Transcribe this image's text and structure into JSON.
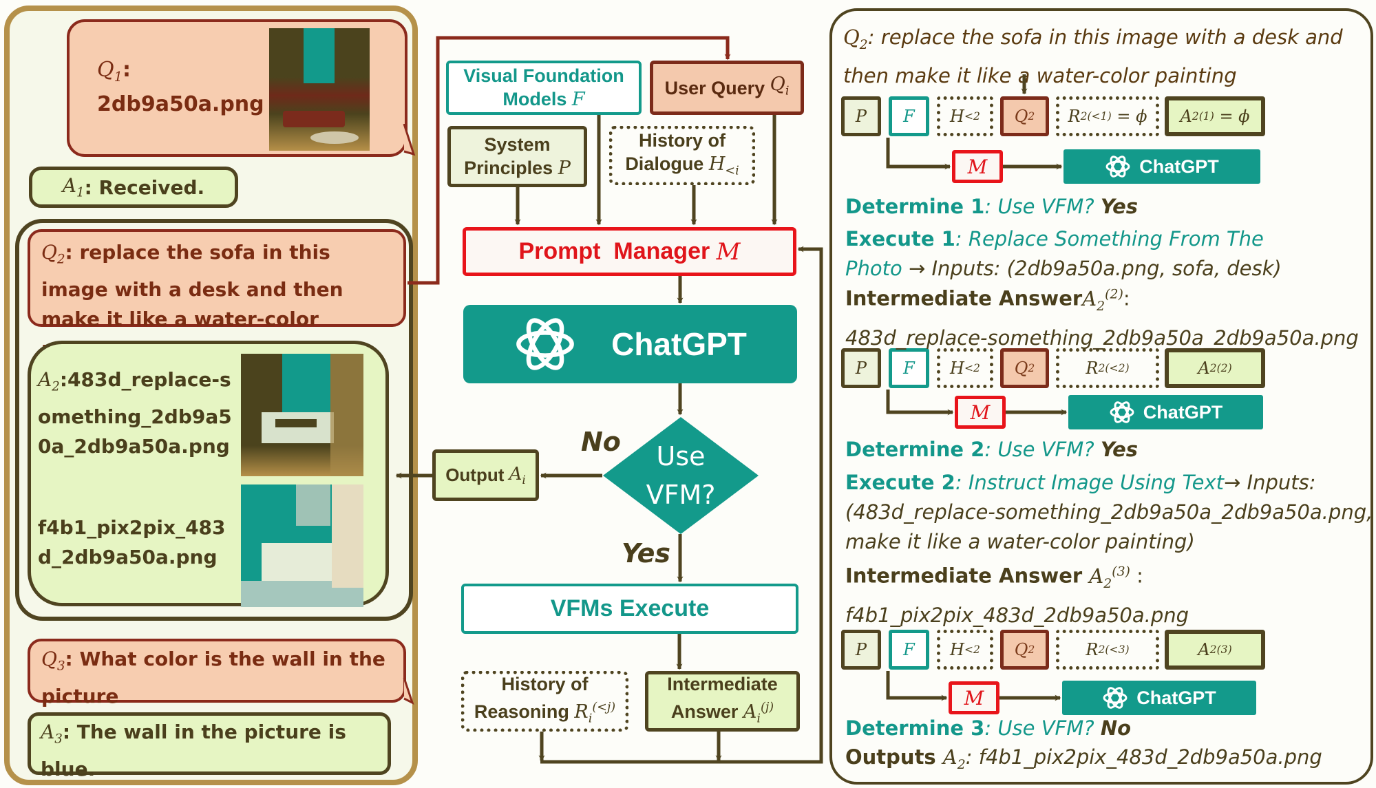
{
  "left_panel": {
    "q1": {
      "label": "Q",
      "sub": "1",
      "colon": ":",
      "text": "2db9a50a.png",
      "image": "living-room-sofa-photo"
    },
    "a1": {
      "label": "A",
      "sub": "1",
      "text": ": Received."
    },
    "q2": {
      "label": "Q",
      "sub": "2",
      "text": ": replace the sofa in this image with a desk and then make it like a water-color painting"
    },
    "a2": {
      "label": "A",
      "sub": "2",
      "text1": ":483d_replace-something_2db9a50a_2db9a50a.png",
      "text2": "f4b1_pix2pix_483d_2db9a50a.png",
      "image1": "desk-replaced-photo",
      "image2": "watercolor-desk-photo"
    },
    "q3": {
      "label": "Q",
      "sub": "3",
      "text": ": What color is the wall in the picture"
    },
    "a3": {
      "label": "A",
      "sub": "3",
      "text": ": The wall in the picture is blue."
    }
  },
  "center": {
    "vfm_box": {
      "line1": "Visual Foundation",
      "line2": "Models",
      "symbol": "F"
    },
    "user_query": {
      "text": "User Query",
      "symbol": "Q",
      "sub": "i"
    },
    "system_principles": {
      "line1": "System",
      "line2": "Principles",
      "symbol": "P"
    },
    "history_dialogue": {
      "line1": "History of",
      "line2": "Dialogue",
      "symbol": "H",
      "sub": "<i"
    },
    "prompt_manager": {
      "text": "Prompt  Manager",
      "symbol": "M"
    },
    "chatgpt": {
      "text": "ChatGPT"
    },
    "decision": {
      "line1": "Use",
      "line2": "VFM?",
      "no_label": "No",
      "yes_label": "Yes"
    },
    "output": {
      "text": "Output",
      "symbol": "A",
      "sub": "i"
    },
    "vfms_execute": {
      "text": "VFMs Execute"
    },
    "history_reasoning": {
      "line1": "History of",
      "line2": "Reasoning",
      "symbol": "R",
      "sub": "i",
      "sup": "(<j)"
    },
    "intermediate": {
      "line1": "Intermediate",
      "line2": "Answer",
      "symbol": "A",
      "sub": "i",
      "sup": "(j)"
    }
  },
  "right_panel": {
    "q2": {
      "label": "Q",
      "sub": "2",
      "line1": ": replace the sofa in this image with a desk and",
      "line2": "then make it like a water-color painting"
    },
    "rows": [
      {
        "chips": {
          "p": "P",
          "f": "F",
          "h": "H",
          "h_sub": "<2",
          "q": "Q",
          "q_sub": "2",
          "r": "R",
          "r_sub": "2",
          "r_sup": "(<1)",
          "r_suffix": " = ϕ",
          "a": "A",
          "a_sub": "2",
          "a_sup": "(1)",
          "a_suffix": " = ϕ"
        },
        "m": "M",
        "chatgpt": "ChatGPT",
        "determine": {
          "label": "Determine 1",
          "q": ": Use VFM? ",
          "answer": "Yes"
        },
        "execute": {
          "label": "Execute 1",
          "tool": ": Replace Something From The",
          "tool2": "Photo",
          "arrow": " → ",
          "inputs": "Inputs: (2db9a50a.png, sofa, desk)"
        },
        "intermediate": {
          "label": "Intermediate Answer",
          "sym": "A",
          "sub": "2",
          "sup": "(2)",
          "colon": ":",
          "value": "483d_replace-something_2db9a50a_2db9a50a.png"
        }
      },
      {
        "chips": {
          "p": "P",
          "f": "F",
          "h": "H",
          "h_sub": "<2",
          "q": "Q",
          "q_sub": "2",
          "r": "R",
          "r_sub": "2",
          "r_sup": "(<2)",
          "r_suffix": "",
          "a": "A",
          "a_sub": "2",
          "a_sup": "(2)",
          "a_suffix": ""
        },
        "m": "M",
        "chatgpt": "ChatGPT",
        "determine": {
          "label": "Determine 2",
          "q": ": Use VFM? ",
          "answer": "Yes"
        },
        "execute": {
          "label": "Execute 2",
          "tool": ": Instruct Image Using Text",
          "arrow": "→ ",
          "inputs": "Inputs:",
          "inputs2": "(483d_replace-something_2db9a50a_2db9a50a.png,",
          "inputs3": "make it like a water-color painting)"
        },
        "intermediate": {
          "label": "Intermediate Answer ",
          "sym": "A",
          "sub": "2",
          "sup": "(3)",
          "colon": " :",
          "value": "f4b1_pix2pix_483d_2db9a50a.png"
        }
      },
      {
        "chips": {
          "p": "P",
          "f": "F",
          "h": "H",
          "h_sub": "<2",
          "q": "Q",
          "q_sub": "2",
          "r": "R",
          "r_sub": "2",
          "r_sup": "(<3)",
          "r_suffix": "",
          "a": "A",
          "a_sub": "2",
          "a_sup": "(3)",
          "a_suffix": ""
        },
        "m": "M",
        "chatgpt": "ChatGPT",
        "determine": {
          "label": "Determine 3",
          "q": ": Use VFM? ",
          "answer": "No"
        },
        "outputs": {
          "label": "Outputs ",
          "sym": "A",
          "sub": "2",
          "value": ": f4b1_pix2pix_483d_2db9a50a.png"
        }
      }
    ]
  },
  "colors": {
    "teal": "#139a8b",
    "query_fill": "#f7cdb0",
    "answer_fill": "#e6f5c3",
    "prompt_red": "#e8141a",
    "dark": "#4f4420",
    "panel_tan": "#b5914a"
  }
}
